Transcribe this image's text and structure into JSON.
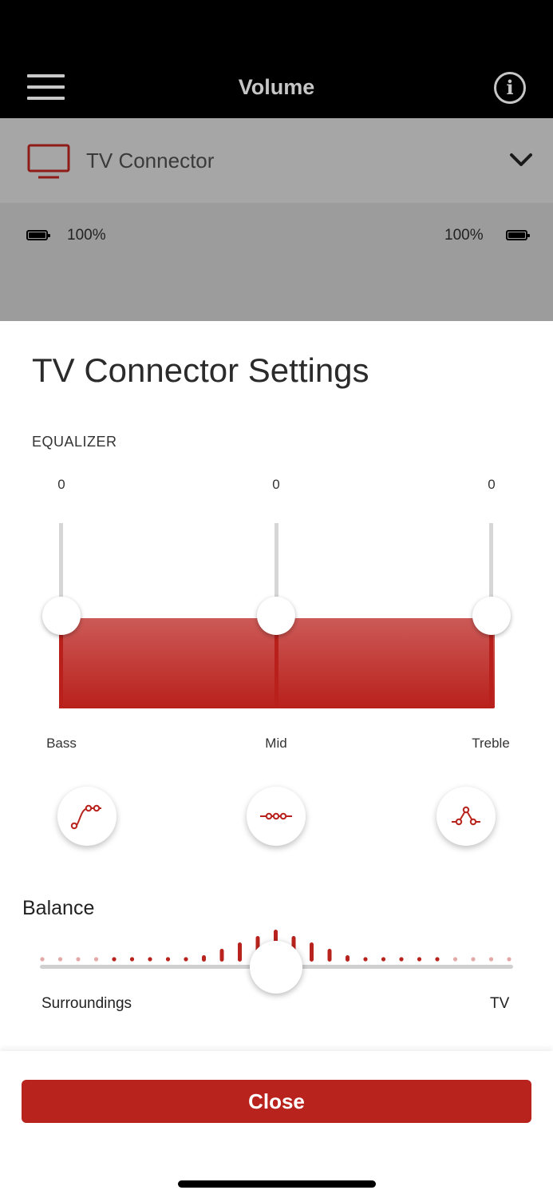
{
  "header": {
    "title": "Volume",
    "menu_icon": "hamburger-menu-icon",
    "info_icon": "info-icon"
  },
  "device": {
    "name": "TV Connector",
    "icon": "tv-icon",
    "dropdown_icon": "chevron-down-icon",
    "battery_left": "100%",
    "battery_right": "100%"
  },
  "settings": {
    "title": "TV Connector Settings",
    "equalizer": {
      "label": "EQUALIZER",
      "bands": [
        {
          "name": "Bass",
          "value": "0"
        },
        {
          "name": "Mid",
          "value": "0"
        },
        {
          "name": "Treble",
          "value": "0"
        }
      ],
      "presets": [
        "bass-boost-preset-icon",
        "flat-preset-icon",
        "mid-boost-preset-icon"
      ]
    },
    "balance": {
      "label": "Balance",
      "left_label": "Surroundings",
      "right_label": "TV",
      "position": 0.5
    }
  },
  "footer": {
    "close_label": "Close"
  },
  "colors": {
    "accent": "#b9231d",
    "topbar": "#000000",
    "dimmed": "#a6a6a6"
  }
}
